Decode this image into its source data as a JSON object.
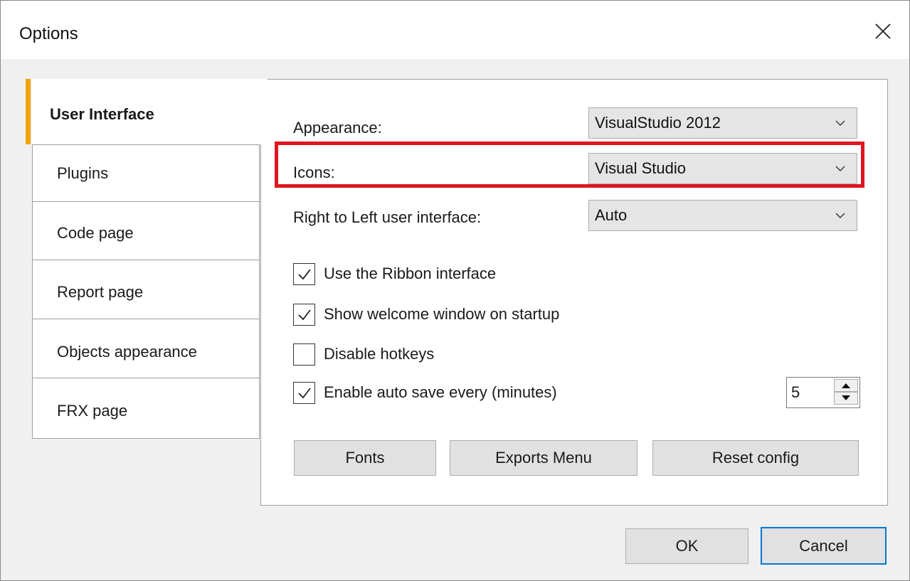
{
  "window": {
    "title": "Options"
  },
  "icons": {
    "close": "close-icon",
    "chevron": "chevron-down-icon",
    "check": "checkmark-icon"
  },
  "colors": {
    "accent": "#f0a30a",
    "highlight": "#e0151f",
    "default_button_border": "#0078d7"
  },
  "tabs": [
    {
      "label": "User Interface",
      "active": true
    },
    {
      "label": "Plugins",
      "active": false
    },
    {
      "label": "Code page",
      "active": false
    },
    {
      "label": "Report page",
      "active": false
    },
    {
      "label": "Objects appearance",
      "active": false
    },
    {
      "label": "FRX page",
      "active": false
    }
  ],
  "settings": {
    "appearance": {
      "label": "Appearance:",
      "value": "VisualStudio 2012"
    },
    "icons": {
      "label": "Icons:",
      "value": "Visual Studio"
    },
    "rtl": {
      "label": "Right to Left user interface:",
      "value": "Auto"
    }
  },
  "checks": [
    {
      "label": "Use the Ribbon interface",
      "checked": true
    },
    {
      "label": "Show welcome window on startup",
      "checked": true
    },
    {
      "label": "Disable hotkeys",
      "checked": false
    },
    {
      "label": "Enable auto save every (minutes)",
      "checked": true
    }
  ],
  "autosave": {
    "minutes": "5"
  },
  "panel_buttons": {
    "fonts": "Fonts",
    "exports": "Exports Menu",
    "reset": "Reset config"
  },
  "dialog_buttons": {
    "ok": "OK",
    "cancel": "Cancel"
  }
}
